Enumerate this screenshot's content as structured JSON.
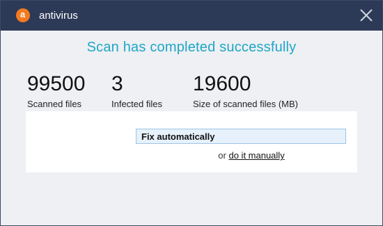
{
  "titlebar": {
    "app_name": "antivirus",
    "logo_icon": "avast-logo-icon",
    "close_icon": "close-icon",
    "background_color": "#2d3a57",
    "logo_color": "#f47a20"
  },
  "heading": "Scan has completed successfully",
  "stats": [
    {
      "value": "99500",
      "label": "Scanned files"
    },
    {
      "value": "3",
      "label": "Infected files"
    },
    {
      "value": "19600",
      "label": "Size of scanned files (MB)"
    }
  ],
  "actions": {
    "fix_label": "Fix automatically",
    "or_text": "or",
    "manual_link": "do it manually"
  },
  "colors": {
    "heading": "#1fa6c7",
    "button_bg": "#e6f1fb",
    "button_border": "#9ec3e6"
  }
}
